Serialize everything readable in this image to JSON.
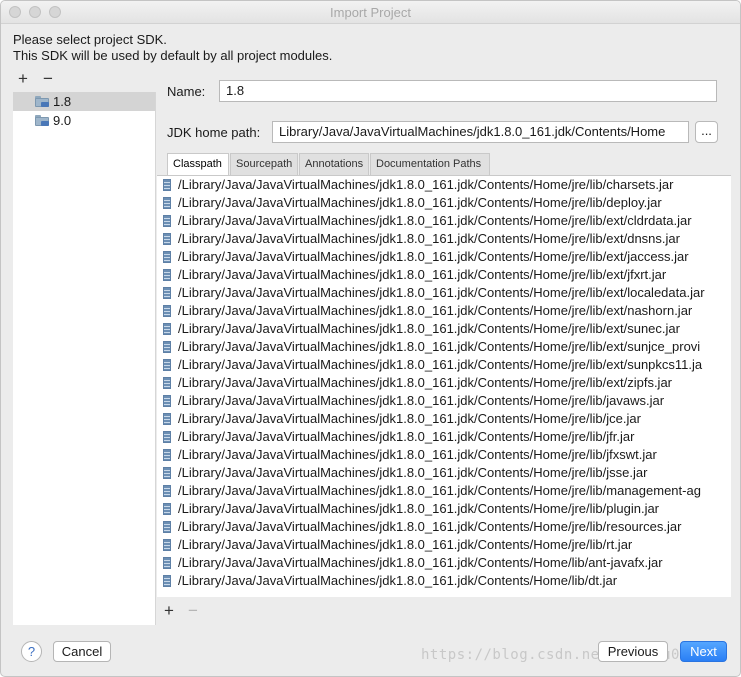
{
  "window": {
    "title": "Import Project"
  },
  "intro": {
    "line1": "Please select project SDK.",
    "line2": "This SDK will be used by default by all project modules."
  },
  "sdk_panel": {
    "add_label": "+",
    "remove_label": "−",
    "items": [
      {
        "label": "1.8",
        "selected": true
      },
      {
        "label": "9.0",
        "selected": false
      }
    ]
  },
  "form": {
    "name_label": "Name:",
    "name_value": "1.8",
    "home_label": "JDK home path:",
    "home_value": "Library/Java/JavaVirtualMachines/jdk1.8.0_161.jdk/Contents/Home",
    "browse_label": "..."
  },
  "tabs": [
    "Classpath",
    "Sourcepath",
    "Annotations",
    "Documentation Paths"
  ],
  "classpath": [
    "/Library/Java/JavaVirtualMachines/jdk1.8.0_161.jdk/Contents/Home/jre/lib/charsets.jar",
    "/Library/Java/JavaVirtualMachines/jdk1.8.0_161.jdk/Contents/Home/jre/lib/deploy.jar",
    "/Library/Java/JavaVirtualMachines/jdk1.8.0_161.jdk/Contents/Home/jre/lib/ext/cldrdata.jar",
    "/Library/Java/JavaVirtualMachines/jdk1.8.0_161.jdk/Contents/Home/jre/lib/ext/dnsns.jar",
    "/Library/Java/JavaVirtualMachines/jdk1.8.0_161.jdk/Contents/Home/jre/lib/ext/jaccess.jar",
    "/Library/Java/JavaVirtualMachines/jdk1.8.0_161.jdk/Contents/Home/jre/lib/ext/jfxrt.jar",
    "/Library/Java/JavaVirtualMachines/jdk1.8.0_161.jdk/Contents/Home/jre/lib/ext/localedata.jar",
    "/Library/Java/JavaVirtualMachines/jdk1.8.0_161.jdk/Contents/Home/jre/lib/ext/nashorn.jar",
    "/Library/Java/JavaVirtualMachines/jdk1.8.0_161.jdk/Contents/Home/jre/lib/ext/sunec.jar",
    "/Library/Java/JavaVirtualMachines/jdk1.8.0_161.jdk/Contents/Home/jre/lib/ext/sunjce_provi",
    "/Library/Java/JavaVirtualMachines/jdk1.8.0_161.jdk/Contents/Home/jre/lib/ext/sunpkcs11.ja",
    "/Library/Java/JavaVirtualMachines/jdk1.8.0_161.jdk/Contents/Home/jre/lib/ext/zipfs.jar",
    "/Library/Java/JavaVirtualMachines/jdk1.8.0_161.jdk/Contents/Home/jre/lib/javaws.jar",
    "/Library/Java/JavaVirtualMachines/jdk1.8.0_161.jdk/Contents/Home/jre/lib/jce.jar",
    "/Library/Java/JavaVirtualMachines/jdk1.8.0_161.jdk/Contents/Home/jre/lib/jfr.jar",
    "/Library/Java/JavaVirtualMachines/jdk1.8.0_161.jdk/Contents/Home/jre/lib/jfxswt.jar",
    "/Library/Java/JavaVirtualMachines/jdk1.8.0_161.jdk/Contents/Home/jre/lib/jsse.jar",
    "/Library/Java/JavaVirtualMachines/jdk1.8.0_161.jdk/Contents/Home/jre/lib/management-ag",
    "/Library/Java/JavaVirtualMachines/jdk1.8.0_161.jdk/Contents/Home/jre/lib/plugin.jar",
    "/Library/Java/JavaVirtualMachines/jdk1.8.0_161.jdk/Contents/Home/jre/lib/resources.jar",
    "/Library/Java/JavaVirtualMachines/jdk1.8.0_161.jdk/Contents/Home/jre/lib/rt.jar",
    "/Library/Java/JavaVirtualMachines/jdk1.8.0_161.jdk/Contents/Home/lib/ant-javafx.jar",
    "/Library/Java/JavaVirtualMachines/jdk1.8.0_161.jdk/Contents/Home/lib/dt.jar"
  ],
  "classpath_tools": {
    "add_label": "+",
    "remove_label": "−"
  },
  "footer": {
    "help_label": "?",
    "cancel_label": "Cancel",
    "previous_label": "Previous",
    "next_label": "Next",
    "watermark": "https://blog.csdn.net/wdz0lu010"
  }
}
